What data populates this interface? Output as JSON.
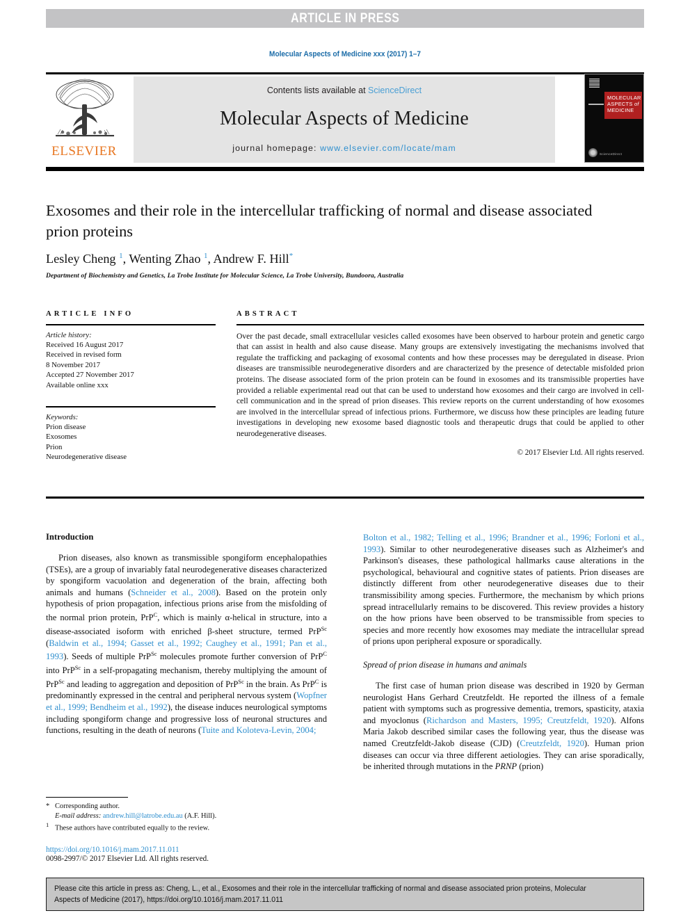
{
  "banner": {
    "label": "ARTICLE IN PRESS"
  },
  "journal_ref": "Molecular Aspects of Medicine xxx (2017) 1–7",
  "masthead": {
    "contents_prefix": "Contents lists available at ",
    "sciencedirect": "ScienceDirect",
    "journal_title": "Molecular Aspects of Medicine",
    "homepage_prefix": "journal homepage: ",
    "homepage_url": "www.elsevier.com/locate/mam",
    "publisher": "ELSEVIER",
    "cover": {
      "title_lines": "MOLECULAR ASPECTS of MEDICINE",
      "bottom_label": "ScienceDirect"
    }
  },
  "title": "Exosomes and their role in the intercellular trafficking of normal and disease associated prion proteins",
  "authors_html": "Lesley Cheng <sup>1</sup>, Wenting Zhao <sup>1</sup>, Andrew F. Hill<sup>*</sup>",
  "affiliation": "Department of Biochemistry and Genetics, La Trobe Institute for Molecular Science, La Trobe University, Bundoora, Australia",
  "article_info": {
    "heading": "ARTICLE INFO",
    "history_label": "Article history:",
    "history": [
      "Received 16 August 2017",
      "Received in revised form",
      "8 November 2017",
      "Accepted 27 November 2017",
      "Available online xxx"
    ],
    "keywords_label": "Keywords:",
    "keywords": [
      "Prion disease",
      "Exosomes",
      "Prion",
      "Neurodegenerative disease"
    ]
  },
  "abstract": {
    "heading": "ABSTRACT",
    "text": "Over the past decade, small extracellular vesicles called exosomes have been observed to harbour protein and genetic cargo that can assist in health and also cause disease. Many groups are extensively investigating the mechanisms involved that regulate the trafficking and packaging of exosomal contents and how these processes may be deregulated in disease. Prion diseases are transmissible neurodegenerative disorders and are characterized by the presence of detectable misfolded prion proteins. The disease associated form of the prion protein can be found in exosomes and its transmissible properties have provided a reliable experimental read out that can be used to understand how exosomes and their cargo are involved in cell-cell communication and in the spread of prion diseases. This review reports on the current understanding of how exosomes are involved in the intercellular spread of infectious prions. Furthermore, we discuss how these principles are leading future investigations in developing new exosome based diagnostic tools and therapeutic drugs that could be applied to other neurodegenerative diseases.",
    "copyright": "© 2017 Elsevier Ltd. All rights reserved."
  },
  "body": {
    "intro_heading": "Introduction",
    "left_para_1": {
      "t1": "Prion diseases, also known as transmissible spongiform encephalopathies (TSEs), are a group of invariably fatal neurodegenerative diseases characterized by spongiform vacuolation and degeneration of the brain, affecting both animals and humans (",
      "r1": "Schneider et al., 2008",
      "t2": "). Based on the protein only hypothesis of prion propagation, infectious prions arise from the misfolding of the normal prion protein, PrP",
      "sup1": "C",
      "t3": ", which is mainly α-helical in structure, into a disease-associated isoform with enriched β-sheet structure, termed PrP",
      "sup2": "Sc",
      "t4": " (",
      "r2": "Baldwin et al., 1994; Gasset et al., 1992; Caughey et al., 1991; Pan et al., 1993",
      "t5": "). Seeds of multiple PrP",
      "sup3": "Sc",
      "t6": " molecules promote further conversion of PrP",
      "sup4": "C",
      "t7": " into PrP",
      "sup5": "Sc",
      "t8": " in a self-propagating mechanism, thereby multiplying the amount of PrP",
      "sup6": "Sc",
      "t9": " and leading to aggregation and deposition of PrP",
      "sup7": "Sc",
      "t10": " in the brain. As PrP",
      "sup8": "C",
      "t11": " is predominantly expressed in the central and peripheral nervous system (",
      "r3": "Wopfner et al., 1999; Bendheim et al., 1992",
      "t12": "), the disease induces neurological symptoms including spongiform change and progressive loss of neuronal structures and functions, resulting in the death of neurons (",
      "r4": "Tuite and Koloteva-Levin, 2004;"
    },
    "right_para_1": {
      "r1": "Bolton et al., 1982; Telling et al., 1996; Brandner et al., 1996; Forloni et al., 1993",
      "t1": "). Similar to other neurodegenerative diseases such as Alzheimer's and Parkinson's diseases, these pathological hallmarks cause alterations in the psychological, behavioural and cognitive states of patients. Prion diseases are distinctly different from other neurodegenerative diseases due to their transmissibility among species. Furthermore, the mechanism by which prions spread intracellularly remains to be discovered. This review provides a history on the how prions have been observed to be transmissible from species to species and more recently how exosomes may mediate the intracellular spread of prions upon peripheral exposure or sporadically."
    },
    "right_heading_2": "Spread of prion disease in humans and animals",
    "right_para_2": {
      "t1": "The first case of human prion disease was described in 1920 by German neurologist Hans Gerhard Creutzfeldt. He reported the illness of a female patient with symptoms such as progressive dementia, tremors, spasticity, ataxia and myoclonus (",
      "r1": "Richardson and Masters, 1995; Creutzfeldt, 1920",
      "t2": "). Alfons Maria Jakob described similar cases the following year, thus the disease was named Creutzfeldt-Jakob disease (CJD) (",
      "r2": "Creutzfeldt, 1920",
      "t3": "). Human prion diseases can occur via three different aetiologies. They can arise sporadically, be inherited through mutations in the ",
      "ital1": "PRNP",
      "t4": " (prion)"
    }
  },
  "footnotes": {
    "corresponding": "Corresponding author.",
    "email_label": "E-mail address:",
    "email": "andrew.hill@latrobe.edu.au",
    "email_suffix": "(A.F. Hill).",
    "equal_contrib": "These authors have contributed equally to the review.",
    "doi": "https://doi.org/10.1016/j.mam.2017.11.011",
    "issn": "0098-2997/© 2017 Elsevier Ltd. All rights reserved."
  },
  "citation_footer": "Please cite this article in press as: Cheng, L., et al., Exosomes and their role in the intercellular trafficking of normal and disease associated prion proteins, Molecular Aspects of Medicine (2017), https://doi.org/10.1016/j.mam.2017.11.011",
  "colors": {
    "link": "#2f8fce",
    "banner_bg": "#c3c3c5",
    "panel_bg": "#e4e4e4",
    "elsevier_orange": "#e87722",
    "cover_red": "#b02020"
  }
}
